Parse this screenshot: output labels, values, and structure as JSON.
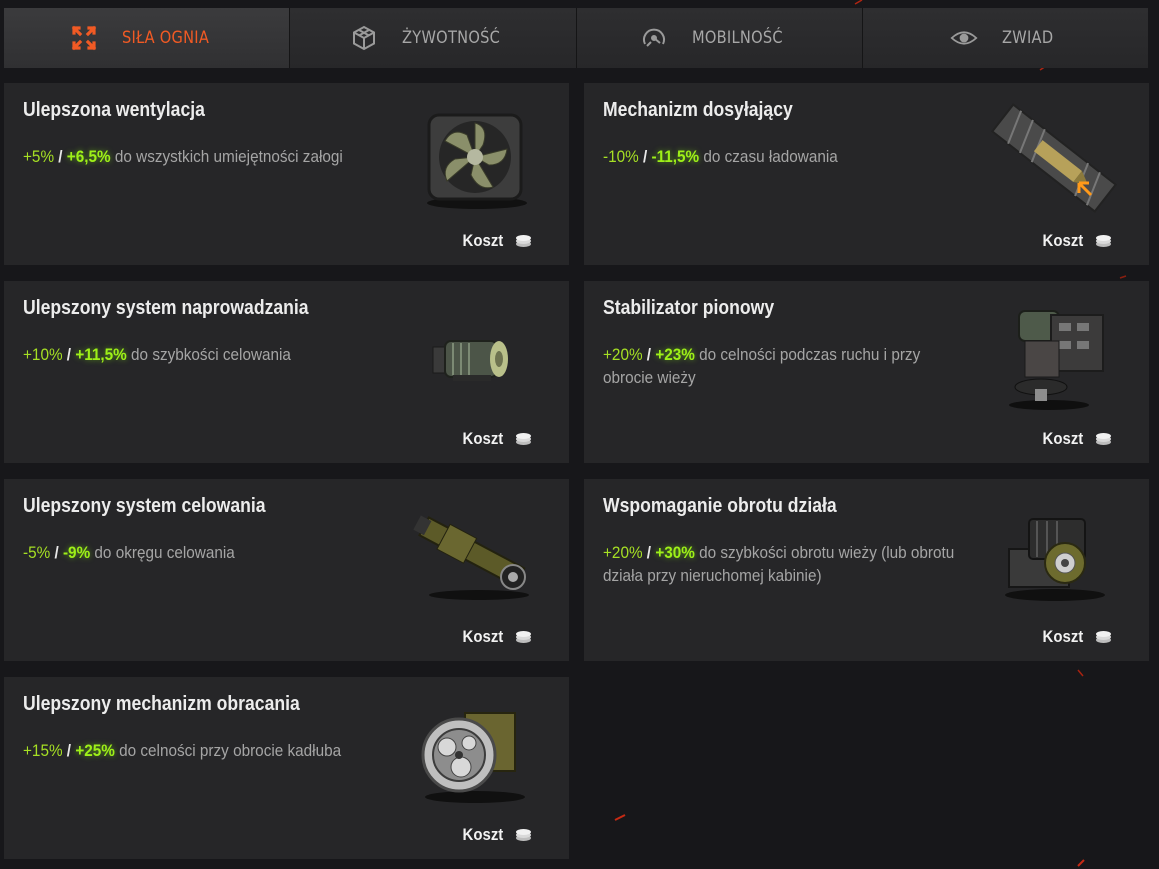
{
  "tabs": [
    {
      "label": "SIŁA OGNIA",
      "icon": "crossed-arrows-icon",
      "active": true
    },
    {
      "label": "ŻYWOTNOŚĆ",
      "icon": "armor-cube-icon",
      "active": false
    },
    {
      "label": "MOBILNOŚĆ",
      "icon": "speedometer-icon",
      "active": false
    },
    {
      "label": "ZWIAD",
      "icon": "eye-icon",
      "active": false
    }
  ],
  "cost_label": "Koszt",
  "cards": [
    {
      "title": "Ulepszona wentylacja",
      "v1": "+5%",
      "sep": " / ",
      "v2": "+6,5%",
      "rest": " do wszystkich umiejętności załogi",
      "icon": "ventilation-fan-icon"
    },
    {
      "title": "Mechanizm dosyłający",
      "v1": "-10%",
      "sep": " / ",
      "v2": "-11,5%",
      "rest": " do czasu ładowania",
      "icon": "rammer-icon"
    },
    {
      "title": "Ulepszony system naprowadzania",
      "v1": "+10%",
      "sep": " / ",
      "v2": "+11,5%",
      "rest": " do szybkości celowania",
      "icon": "gun-laying-drive-icon"
    },
    {
      "title": "Stabilizator pionowy",
      "v1": "+20%",
      "sep": " / ",
      "v2": "+23%",
      "rest": " do celności podczas ruchu i przy obrocie wieży",
      "icon": "vertical-stabilizer-icon"
    },
    {
      "title": "Ulepszony system celowania",
      "v1": "-5%",
      "sep": " / ",
      "v2": "-9%",
      "rest": " do okręgu celowania",
      "icon": "aiming-system-icon"
    },
    {
      "title": "Wspomaganie obrotu działa",
      "v1": "+20%",
      "sep": " / ",
      "v2": "+30%",
      "rest": " do szybkości obrotu wieży (lub obrotu działa przy nieruchomej kabinie)",
      "icon": "gun-traverse-motor-icon"
    },
    {
      "title": "Ulepszony mechanizm obracania",
      "v1": "+15%",
      "sep": " / ",
      "v2": "+25%",
      "rest": " do celności przy obrocie kadłuba",
      "icon": "turning-mechanism-icon"
    }
  ],
  "colors": {
    "accent": "#f15a24",
    "bonus": "#9ef018",
    "card": "#262628",
    "background": "#17171a"
  }
}
